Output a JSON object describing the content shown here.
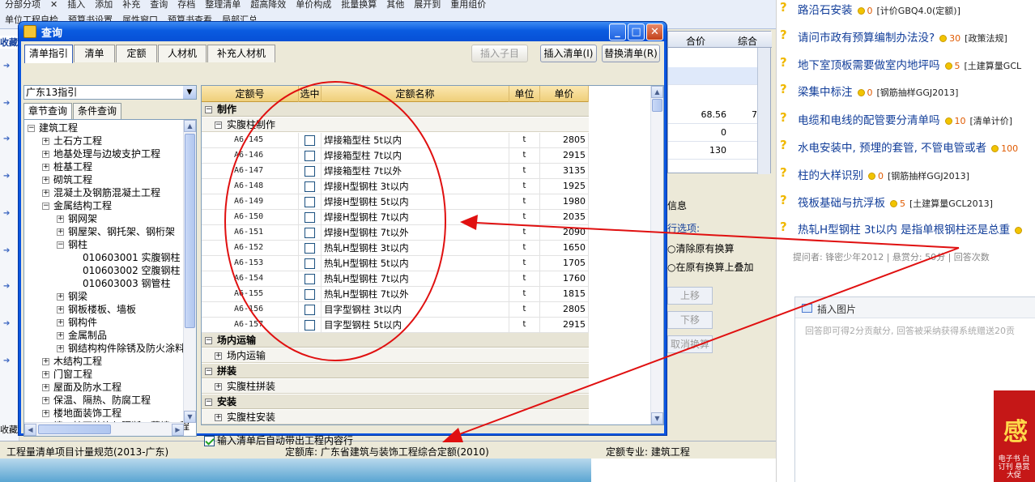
{
  "background_app": {
    "toolbar_row1": [
      "分部分项",
      "✕",
      "插入",
      "添加",
      "补充",
      "查询",
      "存档",
      "整理清单",
      "超高降效",
      "单价构成",
      "批量换算",
      "其他",
      "展开到",
      "重用组价"
    ],
    "toolbar_row2": [
      "单位工程自检",
      "预算书设置",
      "属性窗口",
      "预算书查看",
      "局部汇总"
    ],
    "left_tab": "收藏",
    "left_tab2": "收藏",
    "grid_headers": [
      "合价",
      "综合"
    ],
    "grid_values": [
      "68.56",
      "0",
      "130"
    ],
    "grid_value_extra": "7",
    "panel_tab": "信息",
    "panel_options_title": "行选项:",
    "panel_option1": "清除原有换算",
    "panel_option2": "在原有换算上叠加",
    "btn_up": "上移",
    "btn_down": "下移",
    "btn_cancel": "取消换算",
    "status_left": "工程量清单项目计量规范(2013-广东)",
    "status_mid": "定额库: 广东省建筑与装饰工程综合定额(2010)",
    "status_right": "定额专业: 建筑工程"
  },
  "dialog": {
    "title": "查询",
    "tabs": [
      "清单指引",
      "清单",
      "定额",
      "人材机",
      "补充人材机"
    ],
    "btn_insert_child": "插入子目",
    "btn_insert_list": "插入清单(I)",
    "btn_replace_list": "替换清单(R)",
    "region": "广东13指引",
    "subtabs": [
      "章节查询",
      "条件查询"
    ],
    "tree": [
      {
        "label": "建筑工程",
        "level": 0,
        "sign": "−"
      },
      {
        "label": "土石方工程",
        "level": 1,
        "sign": "+"
      },
      {
        "label": "地基处理与边坡支护工程",
        "level": 1,
        "sign": "+"
      },
      {
        "label": "桩基工程",
        "level": 1,
        "sign": "+"
      },
      {
        "label": "砌筑工程",
        "level": 1,
        "sign": "+"
      },
      {
        "label": "混凝土及钢筋混凝土工程",
        "level": 1,
        "sign": "+"
      },
      {
        "label": "金属结构工程",
        "level": 1,
        "sign": "−"
      },
      {
        "label": "钢网架",
        "level": 2,
        "sign": "+"
      },
      {
        "label": "钢屋架、钢托架、钢桁架",
        "level": 2,
        "sign": "+"
      },
      {
        "label": "钢柱",
        "level": 2,
        "sign": "−"
      },
      {
        "label": "010603001  实腹钢柱",
        "level": 3,
        "sign": ""
      },
      {
        "label": "010603002  空腹钢柱",
        "level": 3,
        "sign": ""
      },
      {
        "label": "010603003  钢管柱",
        "level": 3,
        "sign": ""
      },
      {
        "label": "钢梁",
        "level": 2,
        "sign": "+"
      },
      {
        "label": "钢板楼板、墙板",
        "level": 2,
        "sign": "+"
      },
      {
        "label": "钢构件",
        "level": 2,
        "sign": "+"
      },
      {
        "label": "金属制品",
        "level": 2,
        "sign": "+"
      },
      {
        "label": "钢结构构件除锈及防火涂料",
        "level": 2,
        "sign": "+"
      },
      {
        "label": "木结构工程",
        "level": 1,
        "sign": "+"
      },
      {
        "label": "门窗工程",
        "level": 1,
        "sign": "+"
      },
      {
        "label": "屋面及防水工程",
        "level": 1,
        "sign": "+"
      },
      {
        "label": "保温、隔热、防腐工程",
        "level": 1,
        "sign": "+"
      },
      {
        "label": "楼地面装饰工程",
        "level": 1,
        "sign": "+"
      },
      {
        "label": "墙、柱面装饰与隔断、幕墙工程",
        "level": 1,
        "sign": "+"
      }
    ],
    "grid_headers": [
      "定额号",
      "选中",
      "定额名称",
      "单位",
      "单价"
    ],
    "section1": "制作",
    "subsection1": "实腹柱制作",
    "rows": [
      {
        "code": "A6-145",
        "name": "焊接箱型柱 5t以内",
        "unit": "t",
        "price": "2805"
      },
      {
        "code": "A6-146",
        "name": "焊接箱型柱 7t以内",
        "unit": "t",
        "price": "2915"
      },
      {
        "code": "A6-147",
        "name": "焊接箱型柱 7t以外",
        "unit": "t",
        "price": "3135"
      },
      {
        "code": "A6-148",
        "name": "焊接H型钢柱 3t以内",
        "unit": "t",
        "price": "1925"
      },
      {
        "code": "A6-149",
        "name": "焊接H型钢柱 5t以内",
        "unit": "t",
        "price": "1980"
      },
      {
        "code": "A6-150",
        "name": "焊接H型钢柱 7t以内",
        "unit": "t",
        "price": "2035"
      },
      {
        "code": "A6-151",
        "name": "焊接H型钢柱 7t以外",
        "unit": "t",
        "price": "2090"
      },
      {
        "code": "A6-152",
        "name": "热轧H型钢柱 3t以内",
        "unit": "t",
        "price": "1650"
      },
      {
        "code": "A6-153",
        "name": "热轧H型钢柱 5t以内",
        "unit": "t",
        "price": "1705"
      },
      {
        "code": "A6-154",
        "name": "热轧H型钢柱 7t以内",
        "unit": "t",
        "price": "1760"
      },
      {
        "code": "A6-155",
        "name": "热轧H型钢柱 7t以外",
        "unit": "t",
        "price": "1815"
      },
      {
        "code": "A6-156",
        "name": "目字型钢柱 3t以内",
        "unit": "t",
        "price": "2805"
      },
      {
        "code": "A6-157",
        "name": "目字型钢柱 5t以内",
        "unit": "t",
        "price": "2915"
      }
    ],
    "section2": "场内运输",
    "subsection2": "场内运输",
    "section3": "拼装",
    "subsection3": "实腹柱拼装",
    "section4": "安装",
    "subsection4": "实腹柱安装",
    "auto_output_label": "输入清单后自动带出工程内容行"
  },
  "web": {
    "questions": [
      {
        "title": "路沿石安装",
        "score": "0",
        "tag": "[计价GBQ4.0(定额)]"
      },
      {
        "title": "请问市政有预算编制办法没?",
        "score": "30",
        "tag": "[政策法规]"
      },
      {
        "title": "地下室顶板需要做室内地坪吗",
        "score": "5",
        "tag": "[土建算量GCL"
      },
      {
        "title": "梁集中标注",
        "score": "0",
        "tag": "[钢筋抽样GGJ2013]"
      },
      {
        "title": "电缆和电线的配管要分清单吗",
        "score": "10",
        "tag": "[清单计价]"
      },
      {
        "title": "水电安装中, 预埋的套管, 不管电管或者",
        "score": "100",
        "tag": ""
      },
      {
        "title": "柱的大样识别",
        "score": "0",
        "tag": "[钢筋抽样GGJ2013]"
      },
      {
        "title": "筏板基础与抗浮板",
        "score": "5",
        "tag": "[土建算量GCL2013]"
      },
      {
        "title": "热轧H型钢柱 3t以内 是指单根钢柱还是总重",
        "score": "",
        "tag": ""
      }
    ],
    "asker": "提问者: 锋密少年2012  |  悬赏分: 50分  |  回答次数",
    "insert_image": "插入图片",
    "answer_placeholder": "回答即可得2分贡献分, 回答被采纳获得系统赠送20贡",
    "ad_big": "感",
    "ad_small": "电子书 白订刊 悬赏大促"
  },
  "colors": {
    "dialog_blue": "#0a55e0",
    "annotation_red": "#e01010",
    "grid_header": "#efcf7a"
  }
}
